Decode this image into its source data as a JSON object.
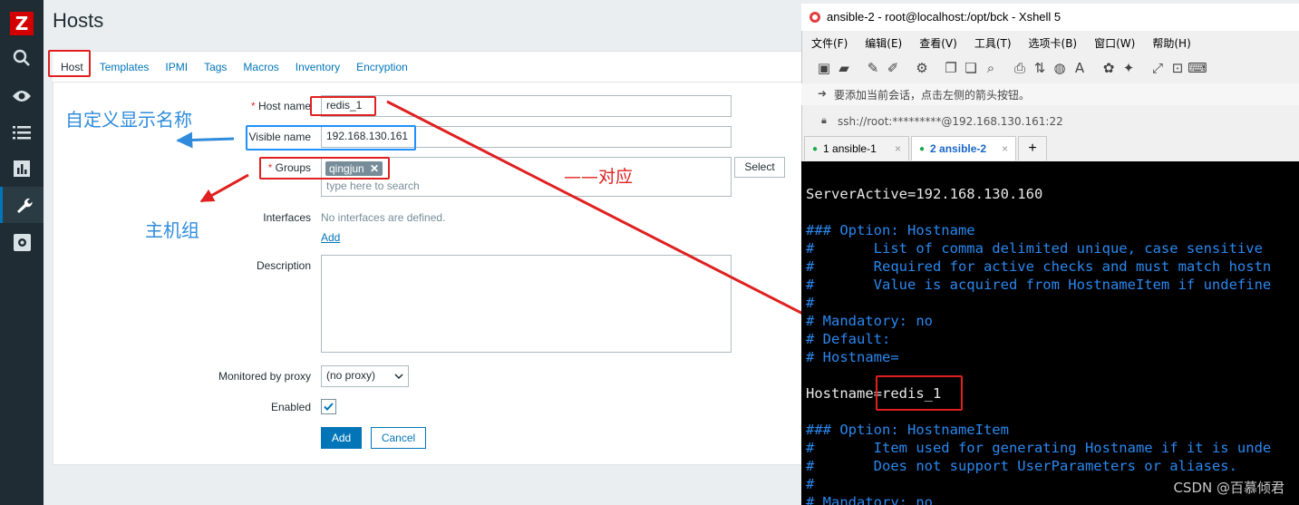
{
  "app": {
    "title": "Hosts",
    "logo": "Z"
  },
  "sidebar": {
    "icons": [
      "search-icon",
      "eye-icon",
      "list-icon",
      "chart-icon",
      "wrench-icon",
      "gear-icon"
    ]
  },
  "tabs": [
    "Host",
    "Templates",
    "IPMI",
    "Tags",
    "Macros",
    "Inventory",
    "Encryption"
  ],
  "form": {
    "host_name_label": "Host name",
    "host_name_value": "redis_1",
    "visible_name_label": "Visible name",
    "visible_name_value": "192.168.130.161",
    "groups_label": "Groups",
    "group_tag": "qingjun",
    "group_tag_remove": "✕",
    "groups_placeholder": "type here to search",
    "select_button": "Select",
    "interfaces_label": "Interfaces",
    "interfaces_empty": "No interfaces are defined.",
    "interfaces_add": "Add",
    "description_label": "Description",
    "proxy_label": "Monitored by proxy",
    "proxy_value": "(no proxy)",
    "enabled_label": "Enabled",
    "enabled_checked": true,
    "required_mark": "*",
    "add_button": "Add",
    "cancel_button": "Cancel"
  },
  "annotations": {
    "visible_name_note": "自定义显示名称",
    "groups_note": "主机组",
    "match_note": "——对应"
  },
  "xshell": {
    "window_title": "ansible-2 - root@localhost:/opt/bck - Xshell 5",
    "menu": [
      "文件(F)",
      "编辑(E)",
      "查看(V)",
      "工具(T)",
      "选项卡(B)",
      "窗口(W)",
      "帮助(H)"
    ],
    "hint": "要添加当前会话，点击左侧的箭头按钮。",
    "address": "ssh://root:*********@192.168.130.161:22",
    "sessions": [
      {
        "label": "1 ansible-1",
        "active": false
      },
      {
        "label": "2 ansible-2",
        "active": true
      }
    ],
    "new_tab": "+",
    "session_close": "×",
    "lines": [
      {
        "text": "ServerActive=192.168.130.160",
        "kind": "w"
      },
      {
        "text": "",
        "kind": "w"
      },
      {
        "text": "### Option: Hostname",
        "kind": "c"
      },
      {
        "text": "#       List of comma delimited unique, case sensitive",
        "kind": "c"
      },
      {
        "text": "#       Required for active checks and must match hostn",
        "kind": "c"
      },
      {
        "text": "#       Value is acquired from HostnameItem if undefine",
        "kind": "c"
      },
      {
        "text": "#",
        "kind": "c"
      },
      {
        "text": "# Mandatory: no",
        "kind": "c"
      },
      {
        "text": "# Default:",
        "kind": "c"
      },
      {
        "text": "# Hostname=",
        "kind": "c"
      },
      {
        "text": "",
        "kind": "w"
      },
      {
        "text": "Hostname=redis_1",
        "kind": "w"
      },
      {
        "text": "",
        "kind": "w"
      },
      {
        "text": "### Option: HostnameItem",
        "kind": "c"
      },
      {
        "text": "#       Item used for generating Hostname if it is unde",
        "kind": "c"
      },
      {
        "text": "#       Does not support UserParameters or aliases.",
        "kind": "c"
      },
      {
        "text": "#",
        "kind": "c"
      },
      {
        "text": "# Mandatory: no",
        "kind": "c"
      }
    ]
  },
  "watermark": "CSDN @百慕倾君",
  "colors": {
    "zabbix_blue": "#0275b8",
    "sidebar": "#1f2c33",
    "annotation_red": "#e02020",
    "annotation_blue": "#2f8cdc",
    "terminal_comment": "#2a88f0"
  }
}
